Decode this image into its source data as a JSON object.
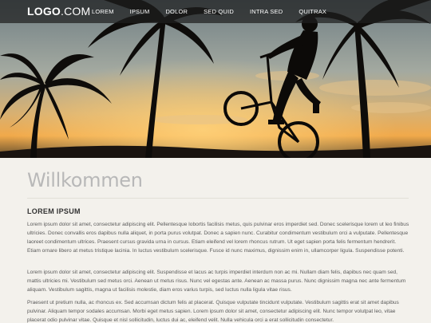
{
  "logo": {
    "bold": "LOGO",
    "light": ".COM"
  },
  "nav": {
    "items": [
      {
        "label": "LOREM"
      },
      {
        "label": "IPSUM"
      },
      {
        "label": "DOLOR"
      },
      {
        "label": "SED QUID"
      },
      {
        "label": "INTRA SED"
      },
      {
        "label": "QUITRAX"
      }
    ]
  },
  "main": {
    "title": "Willkommen",
    "subhead": "LOREM IPSUM",
    "paragraphs": [
      "Lorem ipsum dolor sit amet, consectetur adipiscing elit. Pellentesque lobortis facilisis metus, quis pulvinar eros imperdiet sed. Donec scelerisque lorem ut leo finibus ultricies. Donec convallis eros dapibus nulla aliquet, in porta purus volutpat. Donec a sapien nunc. Curabitur condimentum vestibulum orci a vulputate. Pellentesque laoreet condimentum ultrices. Praesent cursus gravida urna in cursus. Etiam eleifend vel lorem rhoncus rutrum. Ut eget sapien porta felis fermentum hendrerit. Etiam ornare libero at metus tristique lacinia. In luctus vestibulum scelerisque. Fusce id nunc maximus, dignissim enim in, ullamcorper ligula. Suspendisse potenti.",
      "Lorem ipsum dolor sit amet, consectetur adipiscing elit. Suspendisse et lacus ac turpis imperdiet interdum non ac mi. Nullam diam felis, dapibus nec quam sed, mattis ultricies mi. Vestibulum sed metus orci. Aenean ut metus risus. Nunc vel egestas ante. Aenean ac massa purus. Nunc dignissim magna nec ante fermentum aliquam. Vestibulum sagittis, magna ut facilisis molestie, diam eros varius turpis, sed luctus nulla ligula vitae risus.",
      "Praesent ut pretium nulla, ac rhoncus ex. Sed accumsan dictum felis at placerat. Quisque vulputate tincidunt vulputate. Vestibulum sagittis erat sit amet dapibus pulvinar. Aliquam tempor sodales accumsan. Morbi eget metus sapien. Lorem ipsum dolor sit amet, consectetur adipiscing elit. Nunc tempor volutpat leo, vitae placerat odio pulvinar vitae. Quisque et nisl sollicitudin, luctus dui ac, eleifend velit. Nulla vehicula orci a erat sollicitudin consectetur."
    ]
  },
  "colors": {
    "nav_bg": "#1e1e1e",
    "page_bg": "#f3f1ec",
    "title": "#b8b8b8",
    "sky_top": "#6e7f86",
    "sky_glow": "#f0a64a"
  },
  "icons": {
    "hero": "bmx-rider-palm-trees-sunset-photo"
  }
}
